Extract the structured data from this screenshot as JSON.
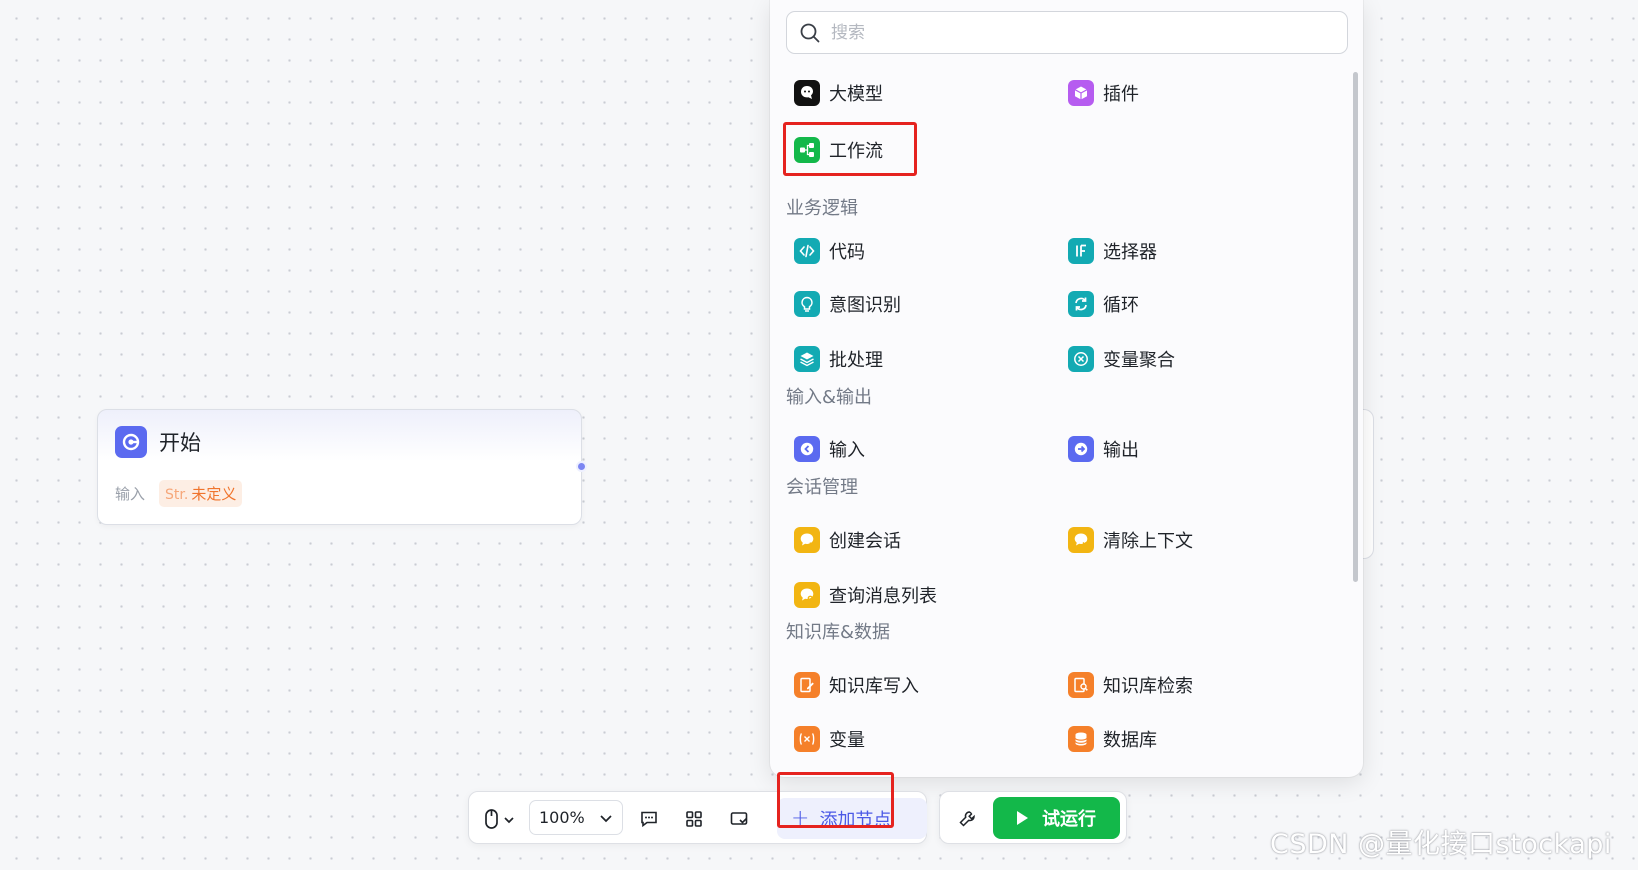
{
  "start_node": {
    "title": "开始",
    "input_label": "输入",
    "type_prefix": "Str.",
    "type_value": "未定义"
  },
  "panel": {
    "search_placeholder": "搜索",
    "top_items": [
      {
        "label": "大模型",
        "icon": "llm-icon",
        "color": "#111111"
      },
      {
        "label": "插件",
        "icon": "plugin-icon",
        "color": "#b65cf0"
      },
      {
        "label": "工作流",
        "icon": "workflow-icon",
        "color": "#13b84a"
      }
    ],
    "sections": [
      {
        "title": "业务逻辑",
        "items": [
          {
            "label": "代码",
            "icon": "code-icon",
            "color": "#13aab3"
          },
          {
            "label": "选择器",
            "icon": "selector-icon",
            "color": "#13aab3"
          },
          {
            "label": "意图识别",
            "icon": "intent-icon",
            "color": "#13aab3"
          },
          {
            "label": "循环",
            "icon": "loop-icon",
            "color": "#13aab3"
          },
          {
            "label": "批处理",
            "icon": "batch-icon",
            "color": "#13aab3"
          },
          {
            "label": "变量聚合",
            "icon": "aggregate-icon",
            "color": "#13aab3"
          }
        ]
      },
      {
        "title": "输入&输出",
        "items": [
          {
            "label": "输入",
            "icon": "input-icon",
            "color": "#5b6af0"
          },
          {
            "label": "输出",
            "icon": "output-icon",
            "color": "#5b6af0"
          }
        ]
      },
      {
        "title": "会话管理",
        "items": [
          {
            "label": "创建会话",
            "icon": "create-session-icon",
            "color": "#f2b512"
          },
          {
            "label": "清除上下文",
            "icon": "clear-context-icon",
            "color": "#f2b512"
          },
          {
            "label": "查询消息列表",
            "icon": "query-messages-icon",
            "color": "#f2b512"
          }
        ]
      },
      {
        "title": "知识库&数据",
        "items": [
          {
            "label": "知识库写入",
            "icon": "knowledge-write-icon",
            "color": "#f5802a"
          },
          {
            "label": "知识库检索",
            "icon": "knowledge-search-icon",
            "color": "#f5802a"
          },
          {
            "label": "变量",
            "icon": "variable-icon",
            "color": "#f5802a"
          },
          {
            "label": "数据库",
            "icon": "database-icon",
            "color": "#f5802a"
          }
        ]
      }
    ]
  },
  "toolbar": {
    "zoom": "100%",
    "add_node_label": "添加节点",
    "run_label": "试运行"
  },
  "watermark": "CSDN @量化接口stockapi"
}
